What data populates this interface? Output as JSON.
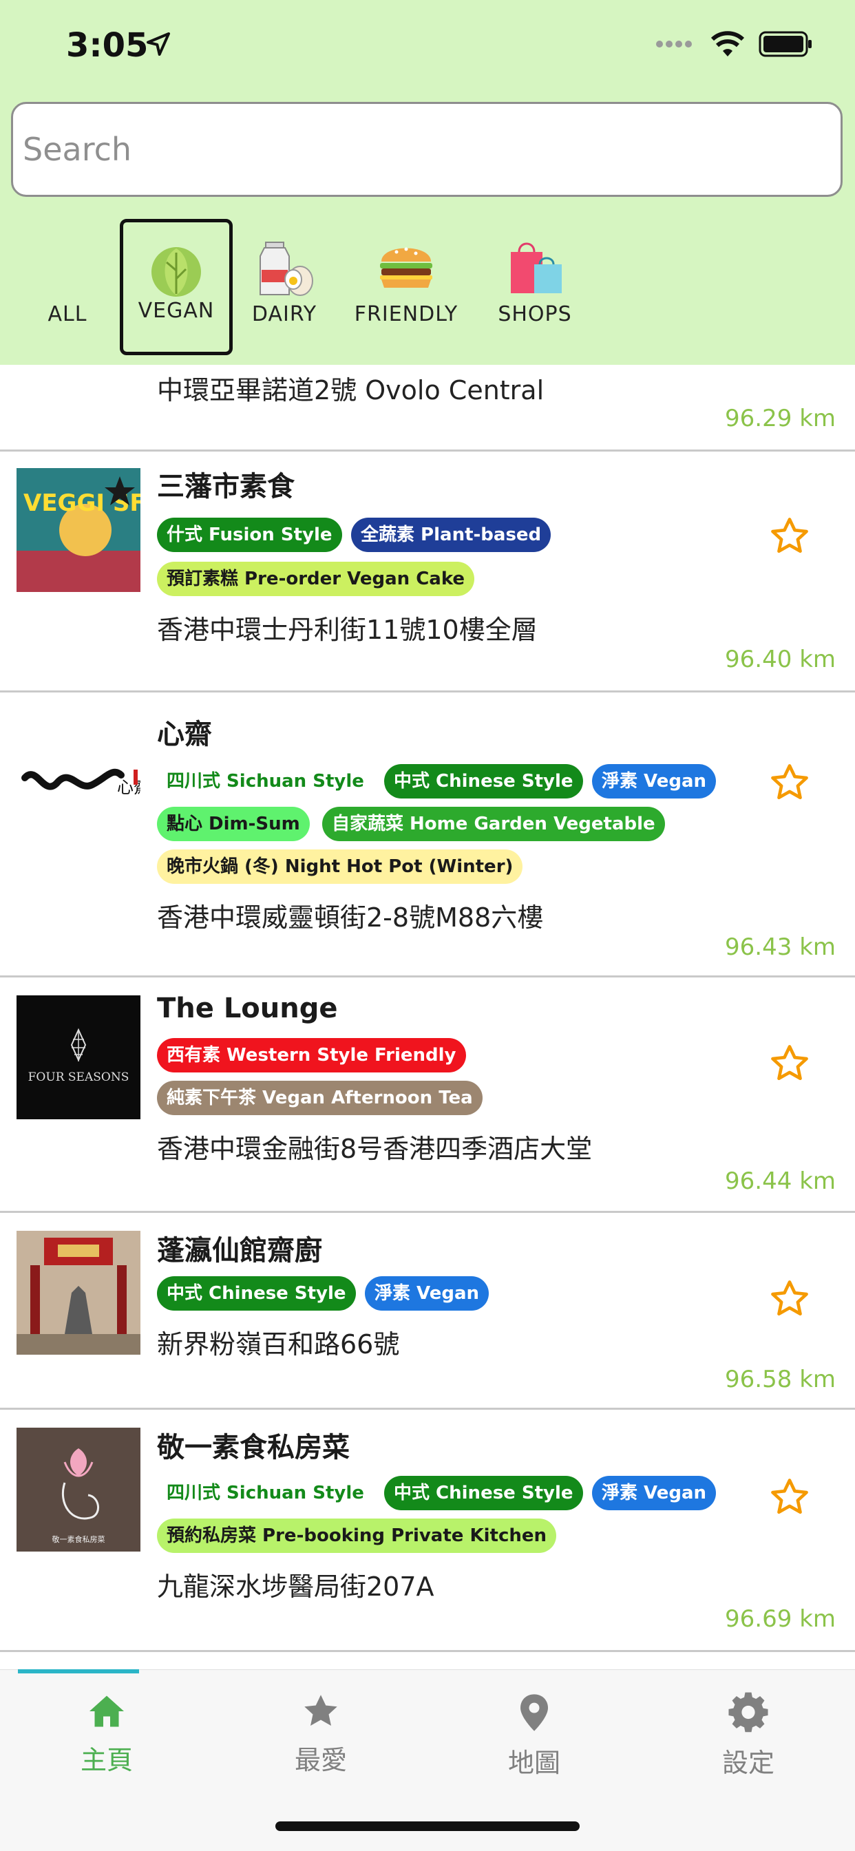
{
  "status": {
    "time": "3:05"
  },
  "search": {
    "placeholder": "Search"
  },
  "categories": [
    {
      "label": "ALL"
    },
    {
      "label": "VEGAN"
    },
    {
      "label": "DAIRY"
    },
    {
      "label": "FRIENDLY"
    },
    {
      "label": "SHOPS"
    }
  ],
  "list": {
    "partial": {
      "address": "中環亞畢諾道2號 Ovolo Central",
      "distance": "96.29 km"
    },
    "items": [
      {
        "title": "三藩市素食",
        "tags": [
          "什式 Fusion Style",
          "全蔬素 Plant-based",
          "預訂素糕 Pre-order Vegan Cake"
        ],
        "address": "香港中環士丹利街11號10樓全層",
        "distance": "96.40 km",
        "thumb_text": "VEGGI SF"
      },
      {
        "title": "心齋",
        "tags": [
          "四川式 Sichuan Style",
          "中式 Chinese Style",
          "淨素 Vegan",
          "點心 Dim-Sum",
          "自家蔬菜 Home Garden Vegetable",
          "晚市火鍋 (冬) Night Hot Pot (Winter)"
        ],
        "address": "香港中環威靈頓街2-8號M88六樓",
        "distance": "96.43 km",
        "thumb_text": "心齋"
      },
      {
        "title": "The Lounge",
        "tags": [
          "西有素 Western Style Friendly",
          "純素下午茶 Vegan Afternoon Tea"
        ],
        "address": "香港中環金融街8号香港四季酒店大堂",
        "distance": "96.44 km",
        "thumb_text": "FOUR SEASONS"
      },
      {
        "title": "蓬瀛仙館齋廚",
        "tags": [
          "中式 Chinese Style",
          "淨素 Vegan"
        ],
        "address": "新界粉嶺百和路66號",
        "distance": "96.58 km"
      },
      {
        "title": "敬一素食私房菜",
        "tags": [
          "四川式 Sichuan Style",
          "中式 Chinese Style",
          "淨素 Vegan",
          "預約私房菜 Pre-booking Private Kitchen"
        ],
        "address": "九龍深水埗醫局街207A",
        "distance": "96.69 km",
        "thumb_text": "敬一素食私房菜"
      }
    ]
  },
  "tabbar": {
    "tabs": [
      {
        "label": "主頁",
        "icon": "home-icon"
      },
      {
        "label": "最愛",
        "icon": "star-icon"
      },
      {
        "label": "地圖",
        "icon": "map-pin-icon"
      },
      {
        "label": "設定",
        "icon": "gear-icon"
      }
    ],
    "active_color": "#4caf50",
    "inactive_color": "#808080"
  },
  "colors": {
    "header_bg": "#d6f5c1",
    "distance": "#8bc34a",
    "star": "#f59a00"
  }
}
